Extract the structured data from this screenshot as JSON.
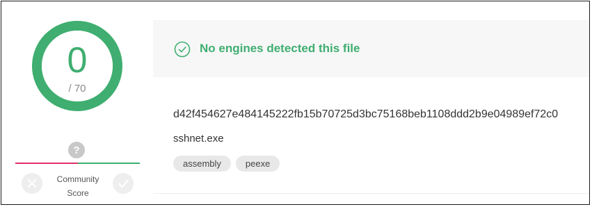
{
  "detection": {
    "score": "0",
    "total": "/ 70",
    "detection_fraction": 0,
    "banner_text": "No engines detected this file",
    "banner_icon": "check-circle-icon",
    "accent_color": "#3fae70"
  },
  "community": {
    "label_line1": "Community",
    "label_line2": "Score",
    "help_icon": "question-icon",
    "negative_color": "#e0316a",
    "positive_color": "#3fae70"
  },
  "file": {
    "hash": "d42f454627e484145222fb15b70725d3bc75168beb1108ddd2b9e04989ef72c0",
    "name": "sshnet.exe",
    "tags": [
      "assembly",
      "peexe"
    ]
  }
}
